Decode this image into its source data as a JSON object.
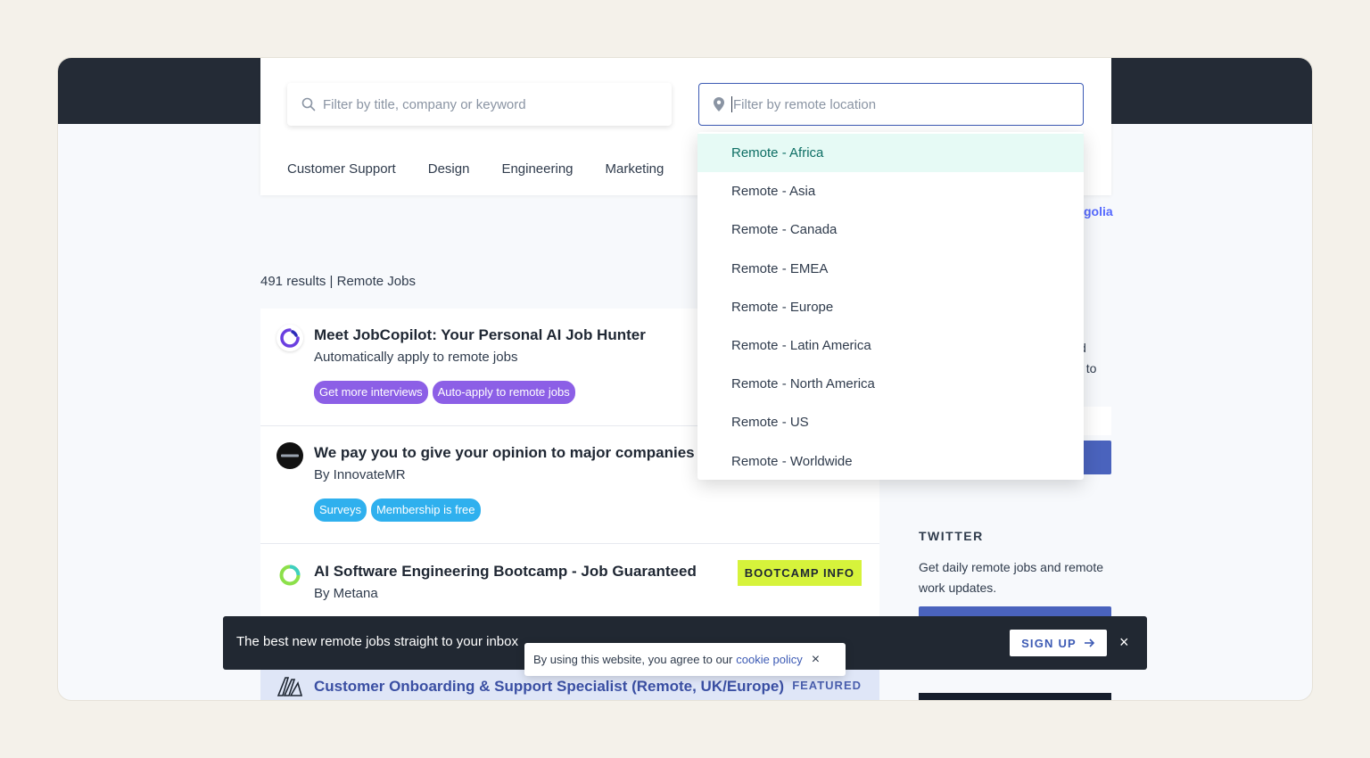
{
  "search": {
    "keyword_placeholder": "Filter by title, company or keyword",
    "location_placeholder": "Filter by remote location"
  },
  "categories": [
    "Customer Support",
    "Design",
    "Engineering",
    "Marketing"
  ],
  "algolia_fragment": "golia",
  "results": {
    "count_text": "491 results",
    "separator": " | ",
    "label": "Remote Jobs"
  },
  "jobs": [
    {
      "title": "Meet JobCopilot: Your Personal AI Job Hunter",
      "subtitle": "Automatically apply to remote jobs",
      "tags": [
        "Get more interviews",
        "Auto-apply to remote jobs"
      ]
    },
    {
      "title": "We pay you to give your opinion to major companies",
      "subtitle": "By InnovateMR",
      "tags": [
        "Surveys",
        "Membership is free"
      ]
    },
    {
      "title": "AI Software Engineering Bootcamp - Job Guaranteed",
      "subtitle": "By Metana",
      "action_label": "BOOTCAMP INFO"
    },
    {
      "title": "Customer Onboarding & Support Specialist (Remote, UK/Europe)",
      "badge": "FEATURED"
    }
  ],
  "location_options": [
    "Remote - Africa",
    "Remote - Asia",
    "Remote - Canada",
    "Remote - EMEA",
    "Remote - Europe",
    "Remote - Latin America",
    "Remote - North America",
    "Remote - US",
    "Remote - Worldwide"
  ],
  "sidebar": {
    "fragment_line1": "d",
    "fragment_line2": "t to",
    "twitter_heading": "TWITTER",
    "twitter_text": "Get daily remote jobs and remote work updates."
  },
  "newsletter": {
    "message": "The best new remote jobs straight to your inbox",
    "signup_label": "SIGN UP",
    "close": "×"
  },
  "cookie": {
    "text": "By using this website, you agree to our",
    "link": "cookie policy",
    "close": "×"
  },
  "colors": {
    "accent": "#3c5ab4",
    "dark_header": "#242b36",
    "tag_purple": "#8c5fe6",
    "tag_blue": "#2fb0ee",
    "bootcamp": "#d6f33b",
    "dropdown_active": "#e6faf5"
  }
}
